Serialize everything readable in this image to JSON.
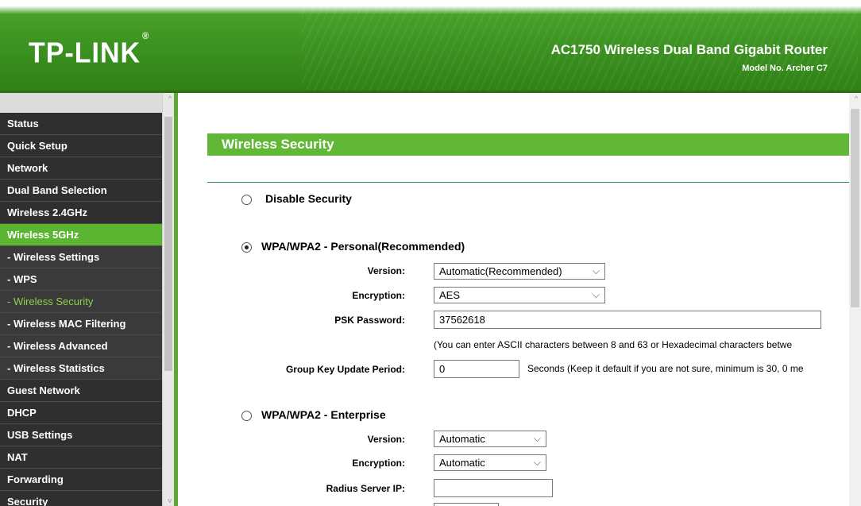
{
  "header": {
    "logo": "TP-LINK",
    "logo_mark": "®",
    "product": "AC1750 Wireless Dual Band Gigabit Router",
    "model": "Model No. Archer C7"
  },
  "sidebar": {
    "items": [
      {
        "label": "Status"
      },
      {
        "label": "Quick Setup"
      },
      {
        "label": "Network"
      },
      {
        "label": "Dual Band Selection"
      },
      {
        "label": "Wireless 2.4GHz"
      },
      {
        "label": "Wireless 5GHz"
      },
      {
        "label": "- Wireless Settings"
      },
      {
        "label": "- WPS"
      },
      {
        "label": "- Wireless Security"
      },
      {
        "label": "- Wireless MAC Filtering"
      },
      {
        "label": "- Wireless Advanced"
      },
      {
        "label": "- Wireless Statistics"
      },
      {
        "label": "Guest Network"
      },
      {
        "label": "DHCP"
      },
      {
        "label": "USB Settings"
      },
      {
        "label": "NAT"
      },
      {
        "label": "Forwarding"
      },
      {
        "label": "Security"
      }
    ]
  },
  "main": {
    "title": "Wireless Security",
    "disable": {
      "label": "Disable Security"
    },
    "personal": {
      "label": "WPA/WPA2 - Personal(Recommended)",
      "version_label": "Version:",
      "version_value": "Automatic(Recommended)",
      "encryption_label": "Encryption:",
      "encryption_value": "AES",
      "psk_label": "PSK Password:",
      "psk_value": "37562618",
      "psk_note": "(You can enter ASCII characters between 8 and 63 or Hexadecimal characters betwe",
      "gkup_label": "Group Key Update Period:",
      "gkup_value": "0",
      "gkup_note": "Seconds (Keep it default if you are not sure, minimum is 30, 0 me"
    },
    "enterprise": {
      "label": "WPA/WPA2 - Enterprise",
      "version_label": "Version:",
      "version_value": "Automatic",
      "encryption_label": "Encryption:",
      "encryption_value": "Automatic",
      "radius_label": "Radius Server IP:",
      "radius_value": ""
    }
  },
  "icons": {
    "chevron": "⌵",
    "scroll_up": "^",
    "scroll_down": "v"
  }
}
